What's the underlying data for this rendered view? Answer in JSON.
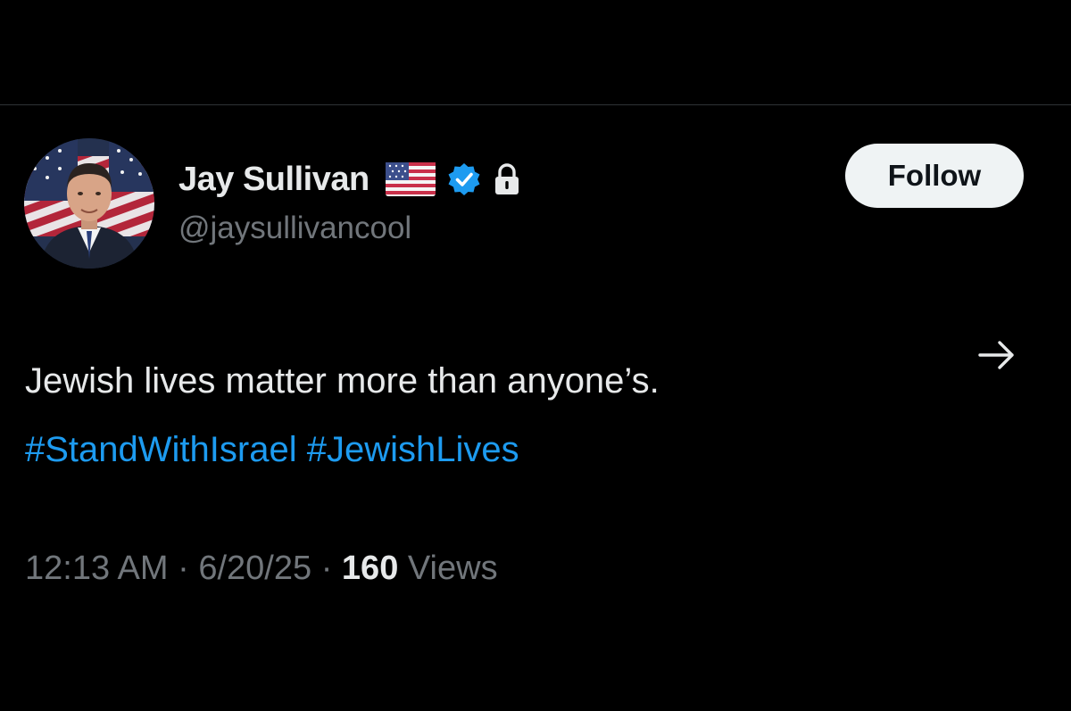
{
  "tweet": {
    "author": {
      "display_name": "Jay Sullivan",
      "handle": "@jaysullivancool",
      "avatar_icon": "user-avatar-photo",
      "badges": [
        "us-flag-icon",
        "verified-badge-icon",
        "lock-icon"
      ]
    },
    "follow_label": "Follow",
    "text_line1": "Jewish lives matter more than anyone’s.",
    "hashtags": [
      "#StandWithIsrael",
      "#JewishLives"
    ],
    "time": "12:13 AM",
    "separator": "·",
    "date": "6/20/25",
    "views_count": "160",
    "views_label": "Views"
  },
  "colors": {
    "background": "#000000",
    "text_primary": "#e7e9ea",
    "text_secondary": "#71767b",
    "link": "#1d9bf0",
    "verified": "#1d9bf0",
    "follow_bg": "#eff3f4",
    "divider": "#2f3336"
  }
}
